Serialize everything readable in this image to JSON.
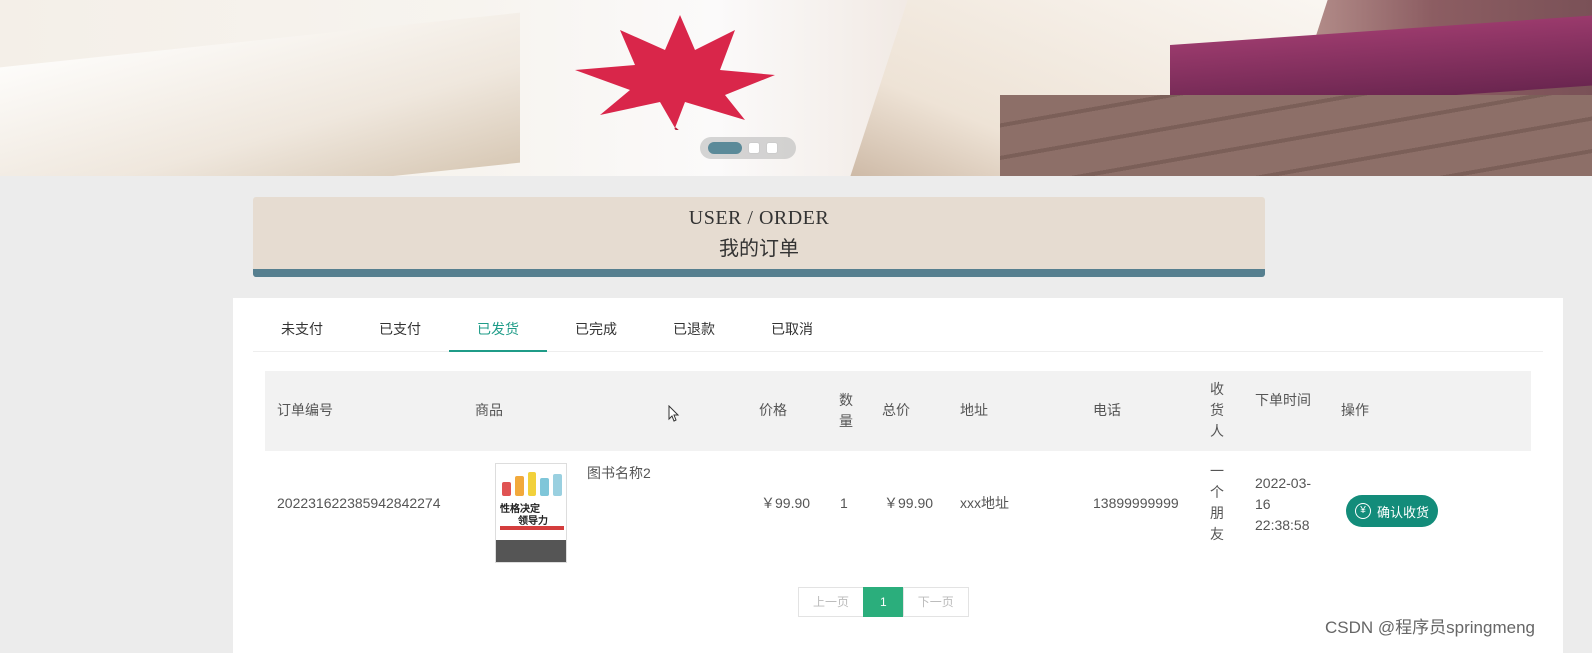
{
  "header": {
    "title_en": "USER / ORDER",
    "title_cn": "我的订单"
  },
  "carousel": {
    "slides": 3,
    "active": 0
  },
  "tabs": [
    {
      "label": "未支付"
    },
    {
      "label": "已支付"
    },
    {
      "label": "已发货"
    },
    {
      "label": "已完成"
    },
    {
      "label": "已退款"
    },
    {
      "label": "已取消"
    }
  ],
  "active_tab": 2,
  "table": {
    "headers": {
      "order_no": "订单编号",
      "product": "商品",
      "price": "价格",
      "qty": "数量",
      "total": "总价",
      "address": "地址",
      "phone": "电话",
      "receiver": "收货人",
      "time": "下单时间",
      "action": "操作"
    },
    "rows": [
      {
        "order_no": "20223162238594284227​4",
        "book_name": "图书名称2",
        "cover_title_1": "性格决定",
        "cover_title_2": "领导力",
        "price": "￥99.90",
        "qty": "1",
        "total": "￥99.90",
        "address": "xxx地址",
        "phone": "13899999999",
        "receiver": "一个朋友",
        "time": "2022-03-16 22:38:58",
        "action_label": "确认收货",
        "action_icon": "yen-circle-icon"
      }
    ]
  },
  "pagination": {
    "prev": "上一页",
    "current": "1",
    "next": "下一页"
  },
  "watermark": "CSDN @程序员springmeng",
  "colors": {
    "accent": "#1f9c88",
    "button": "#138c7a",
    "page_current": "#2bae7c",
    "title_bar": "#567f8f",
    "title_bg": "#e6dcd1"
  }
}
